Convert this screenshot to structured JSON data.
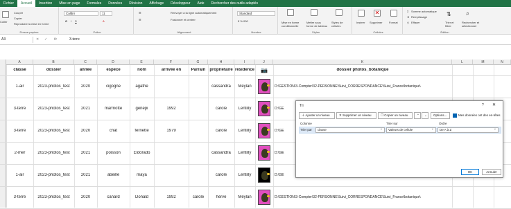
{
  "menu": [
    "Fichier",
    "Accueil",
    "Insertion",
    "Mise en page",
    "Formules",
    "Données",
    "Révision",
    "Affichage",
    "Développeur",
    "Aide",
    "Rechercher des outils adaptés"
  ],
  "ribbon": {
    "clipboard": {
      "label": "Presse-papiers",
      "paste": "Coller",
      "cut": "Couper",
      "copy": "Copier",
      "painter": "Reproduire la mise en forme"
    },
    "font": {
      "label": "Police",
      "family": "Calibri",
      "size": "11"
    },
    "alignment": {
      "label": "Alignement",
      "wrap": "Renvoyer à la ligne automatiquement",
      "merge": "Fusionner et centrer"
    },
    "number": {
      "label": "Nombre",
      "format": "Standard"
    },
    "styles": {
      "label": "Styles",
      "conditional": "Mise en forme conditionnelle",
      "table": "Mettre sous forme de tableau",
      "cell_styles": "Styles de cellules"
    },
    "cells": {
      "label": "Cellules",
      "insert": "Insérer",
      "delete": "Supprimer",
      "format": "Format"
    },
    "editing": {
      "label": "Édition",
      "autosum": "Somme automatique",
      "fill": "Remplissage",
      "clear": "Effacer",
      "sort": "Trier et filtrer",
      "find": "Rechercher et sélectionner"
    }
  },
  "formula_bar": {
    "name_box": "A3",
    "fx": "fx",
    "value": "3-terre"
  },
  "columns": [
    "A",
    "B",
    "C",
    "D",
    "E",
    "F",
    "G",
    "H",
    "I",
    "J",
    "K",
    "L",
    "M",
    "N"
  ],
  "headers": [
    "classe",
    "dossier",
    "année",
    "espèce",
    "nom",
    "arrivée en",
    "Parrain",
    "propriétaire",
    "résidence",
    "",
    "dossier photos_botanique"
  ],
  "rows": [
    [
      "1-air",
      "2023-photos_test",
      "2020",
      "cigogne",
      "agathe",
      "",
      "",
      "cassandra",
      "Meylan",
      "pink",
      "D:\\GESTION\\3-Compter\\32-PERSONNE\\Suivi_CORRESPONDANCE\\Suivi_France\\botanique\\"
    ],
    [
      "3-terre",
      "2023-photos_test",
      "2021",
      "marmotte",
      "genépi",
      "1992",
      "",
      "carole",
      "Lentilly",
      "pink",
      "D:\\GE"
    ],
    [
      "3-terre",
      "2023-photos_test",
      "2020",
      "chat",
      "fernette",
      "1979",
      "",
      "carole",
      "Lentilly",
      "pink",
      "D:\\GE"
    ],
    [
      "2-mer",
      "2023-photos_test",
      "2021",
      "poisson",
      "Eldorado",
      "",
      "",
      "cassandra",
      "Lentilly",
      "pink",
      "D:\\GE"
    ],
    [
      "1-air",
      "2023-photos_test",
      "2021",
      "abeille",
      "maya",
      "",
      "",
      "carole",
      "Lentilly",
      "dark",
      "D:\\GE"
    ],
    [
      "3-terre",
      "2023-photos_test",
      "2020",
      "canard",
      "Donald",
      "1992",
      "carole",
      "hervé",
      "Meylan",
      "pink",
      "D:\\GESTION\\3-Compter\\32-PERSONNE\\Suivi_CORRESPONDANCE\\Suivi_France\\botanique\\"
    ]
  ],
  "sort_dialog": {
    "title": "Tri",
    "help": "?",
    "close": "✕",
    "add_level": "Ajouter un niveau",
    "delete_level": "Supprimer un niveau",
    "copy_level": "Copier un niveau",
    "options": "Options...",
    "has_headers": "Mes données ont des en-têtes",
    "col_header": "Colonne",
    "sort_on_header": "Trier sur",
    "order_header": "Ordre",
    "sort_by": "Trier par",
    "column_value": "classe",
    "sort_on_value": "Valeurs de cellule",
    "order_value": "De A à Z",
    "ok": "OK",
    "cancel": "Annuler"
  }
}
